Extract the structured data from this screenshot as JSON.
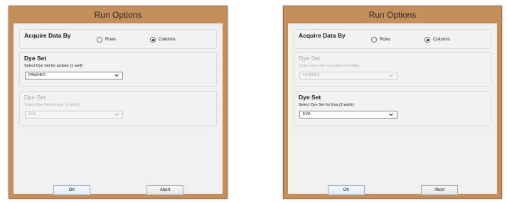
{
  "dialog_left": {
    "title": "Run Options",
    "acquire": {
      "title": "Acquire Data By",
      "options": [
        "Rows",
        "Columns"
      ],
      "selected": "Columns"
    },
    "probe_set": {
      "title": "Dye Set",
      "label": "Select Dye Set for probes (1 well):",
      "value": "FAM/HEX",
      "enabled": true
    },
    "eva_set": {
      "title": "Dye Set",
      "label": "Select Dye Set for Eva (0 wells):",
      "value": "EVA",
      "enabled": false
    },
    "buttons": {
      "ok": "OK",
      "abort": "Abort"
    }
  },
  "dialog_right": {
    "title": "Run Options",
    "acquire": {
      "title": "Acquire Data By",
      "options": [
        "Rows",
        "Columns"
      ],
      "selected": "Columns"
    },
    "probe_set": {
      "title": "Dye Set",
      "label": "Select Dye Set for probes (0 wells):",
      "value": "FAM/HEX",
      "enabled": false
    },
    "eva_set": {
      "title": "Dye Set",
      "label": "Select Dye Set for Eva (2 wells):",
      "value": "EVA",
      "enabled": true
    },
    "buttons": {
      "ok": "OK",
      "abort": "Abort"
    }
  },
  "colors": {
    "frame": "#c58f5b",
    "client": "#f0f0f0",
    "disabled_text": "#b0b0b0"
  },
  "icons": {
    "dropdown": "chevron-down-icon",
    "radio": "radio-button-icon"
  }
}
